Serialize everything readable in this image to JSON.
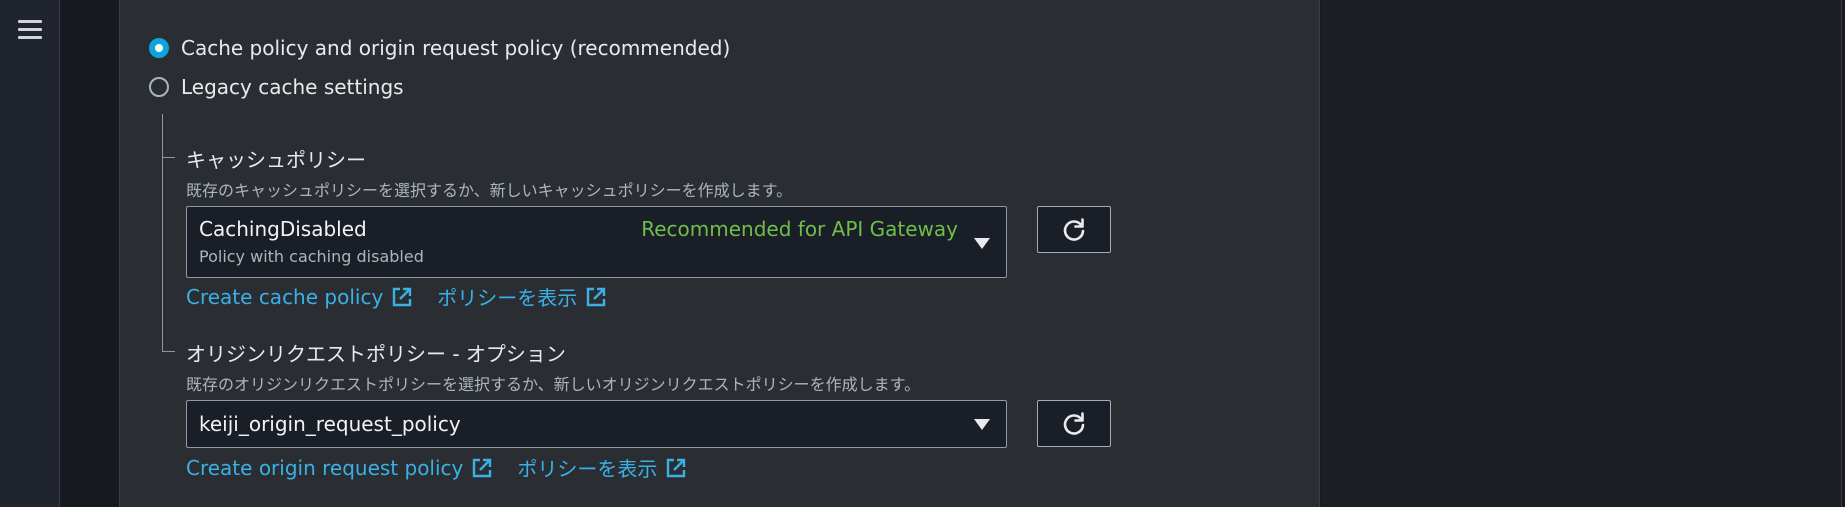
{
  "nav": {
    "menu_icon": "hamburger-menu-icon"
  },
  "origin_settings": {
    "options": [
      {
        "label": "Cache policy and origin request policy (recommended)",
        "selected": true
      },
      {
        "label": "Legacy cache settings",
        "selected": false
      }
    ]
  },
  "cache_policy": {
    "title": "キャッシュポリシー",
    "description": "既存のキャッシュポリシーを選択するか、新しいキャッシュポリシーを作成します。",
    "selected_value": "CachingDisabled",
    "selected_description": "Policy with caching disabled",
    "recommendation": "Recommended for API Gateway",
    "refresh_icon": "refresh-icon",
    "links": [
      {
        "label": "Create cache policy",
        "icon": "external-link-icon"
      },
      {
        "label": "ポリシーを表示",
        "icon": "external-link-icon"
      }
    ]
  },
  "origin_request_policy": {
    "title": "オリジンリクエストポリシー - オプション",
    "description": "既存のオリジンリクエストポリシーを選択するか、新しいオリジンリクエストポリシーを作成します。",
    "selected_value": "keiji_origin_request_policy",
    "refresh_icon": "refresh-icon",
    "links": [
      {
        "label": "Create origin request policy",
        "icon": "external-link-icon"
      },
      {
        "label": "ポリシーを表示",
        "icon": "external-link-icon"
      }
    ]
  },
  "colors": {
    "accent": "#0ea5d9",
    "link": "#39b1e6",
    "recommended": "#6fbe49",
    "panel_bg": "#2a2e33",
    "input_bg": "#1a1f27"
  }
}
